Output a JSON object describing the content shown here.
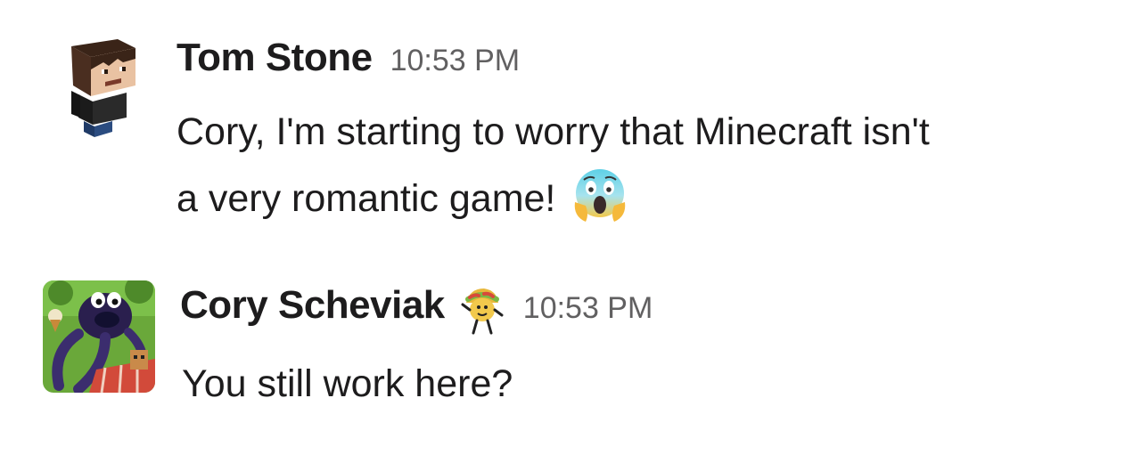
{
  "messages": [
    {
      "sender": "Tom Stone",
      "time": "10:53 PM",
      "avatar_icon": "minecraft-character-avatar",
      "lines": [
        "Cory, I'm starting to worry that Minecraft isn't",
        "a very romantic game!"
      ],
      "emoji": "face-screaming-in-fear-icon"
    },
    {
      "sender": "Cory Scheviak",
      "time": "10:53 PM",
      "avatar_icon": "cartoon-creature-avatar",
      "status_emoji": "taco-character-icon",
      "lines": [
        "You still work here?"
      ]
    }
  ]
}
